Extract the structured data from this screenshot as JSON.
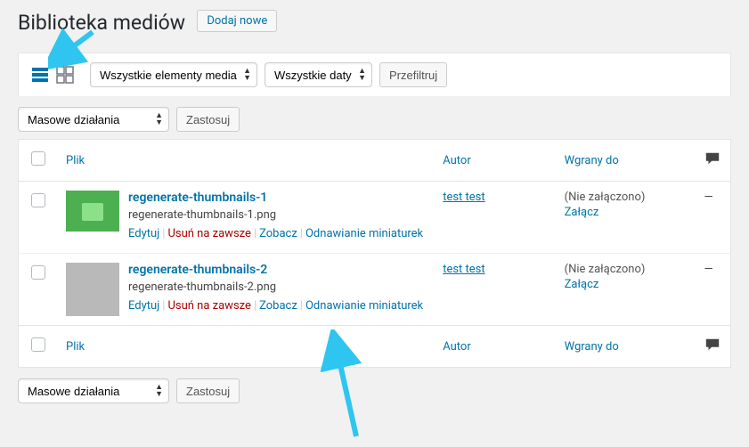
{
  "header": {
    "title": "Biblioteka mediów",
    "add_new": "Dodaj nowe"
  },
  "filters": {
    "media_type": "Wszystkie elementy media",
    "dates": "Wszystkie daty",
    "filter_button": "Przefiltruj"
  },
  "bulk": {
    "label": "Masowe działania",
    "apply": "Zastosuj"
  },
  "columns": {
    "file": "Plik",
    "author": "Autor",
    "uploaded_to": "Wgrany do"
  },
  "row_actions": {
    "edit": "Edytuj",
    "delete": "Usuń na zawsze",
    "view": "Zobacz",
    "regenerate": "Odnawianie miniaturek"
  },
  "uploaded": {
    "not_attached": "(Nie załączono)",
    "attach": "Załącz"
  },
  "comments_dash": "—",
  "rows": [
    {
      "title": "regenerate-thumbnails-1",
      "filename": "regenerate-thumbnails-1.png",
      "author": "test test"
    },
    {
      "title": "regenerate-thumbnails-2",
      "filename": "regenerate-thumbnails-2.png",
      "author": "test test"
    }
  ]
}
